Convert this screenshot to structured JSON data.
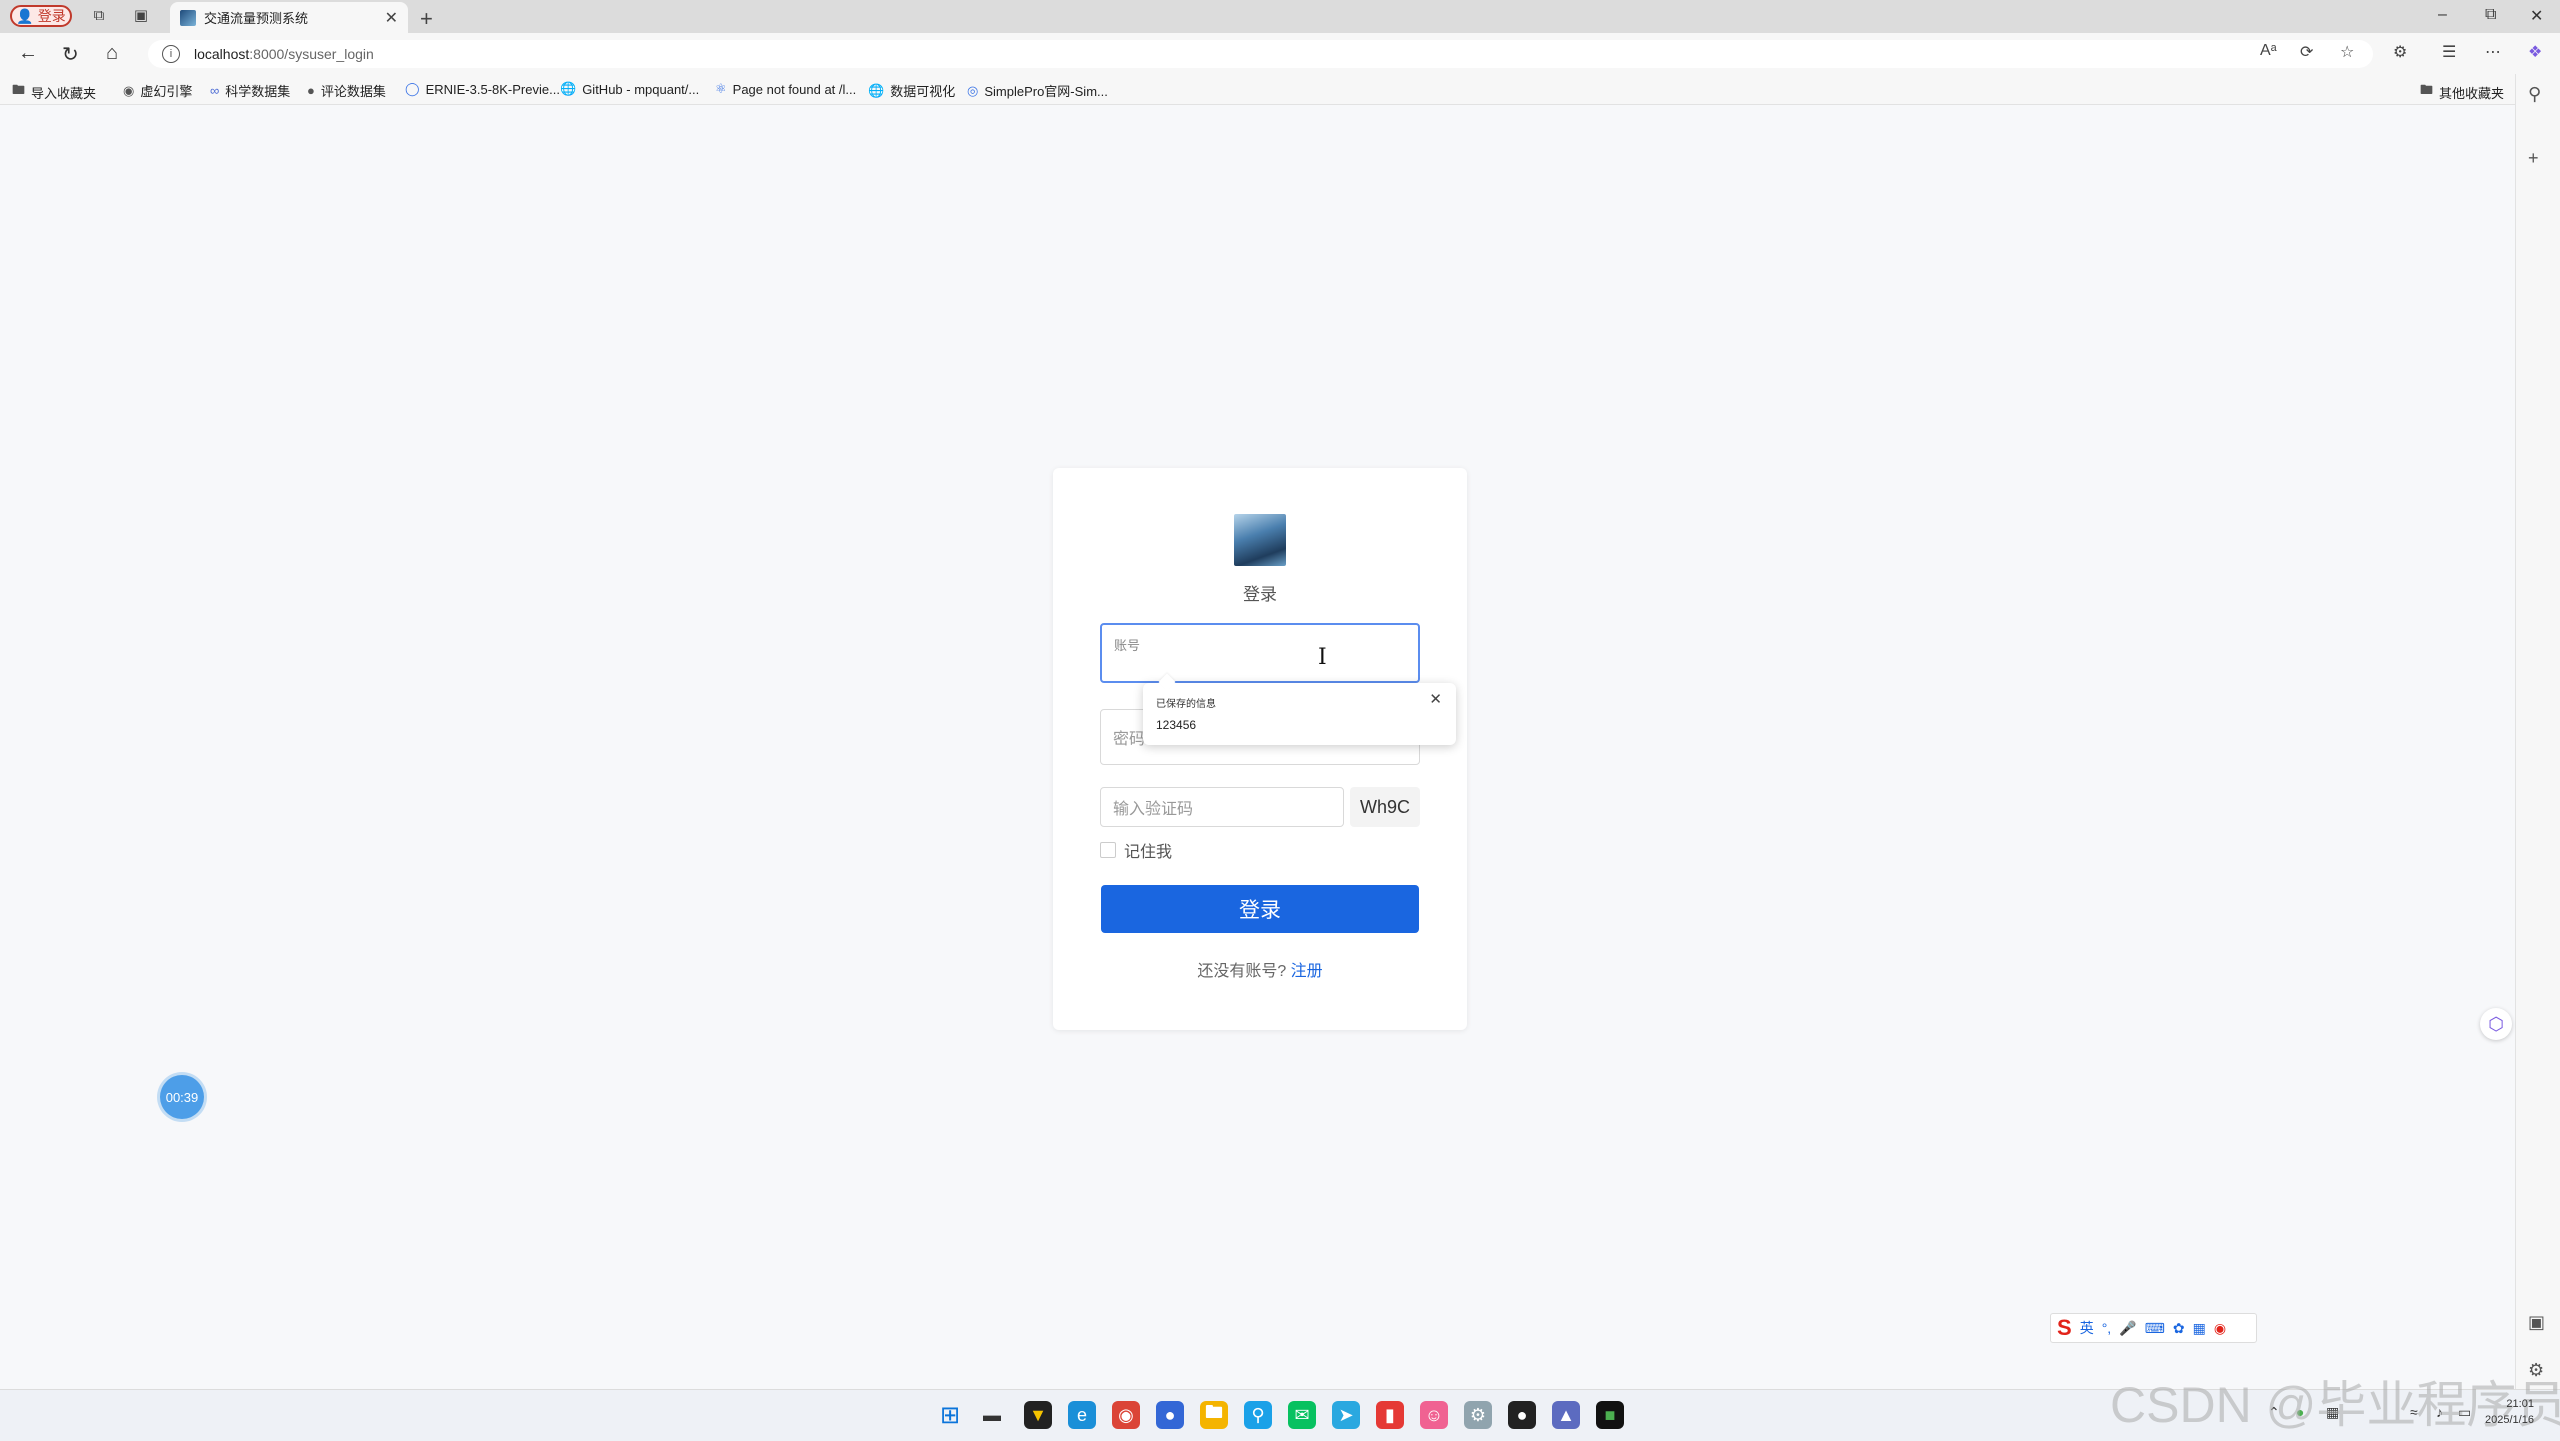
{
  "browser": {
    "profile_label": "登录",
    "tab_title": "交通流量预测系统",
    "url_host": "localhost",
    "url_path": ":8000/sysuser_login",
    "bookmarks": [
      "导入收藏夹",
      "虚幻引擎",
      "科学数据集",
      "评论数据集",
      "ERNIE-3.5-8K-Previe...",
      "GitHub - mpquant/...",
      "Page not found at /l...",
      "数据可视化",
      "SimplePro官网-Sim..."
    ],
    "other_bookmarks": "其他收藏夹"
  },
  "login": {
    "title": "登录",
    "account_placeholder": "账号",
    "password_placeholder": "密码",
    "captcha_placeholder": "输入验证码",
    "captcha_code": "Wh9C",
    "remember_label": "记住我",
    "login_button": "登录",
    "no_account_text": "还没有账号?",
    "register_link": "注册"
  },
  "autofill": {
    "title": "已保存的信息",
    "value": "123456"
  },
  "timer": "00:39",
  "ime": {
    "lang": "英"
  },
  "watermark": "CSDN @毕业程序员",
  "clock": {
    "time": "21:01",
    "date": "2025/1/16"
  },
  "colors": {
    "primary": "#1a66e0",
    "focus_border": "#5b8def"
  }
}
